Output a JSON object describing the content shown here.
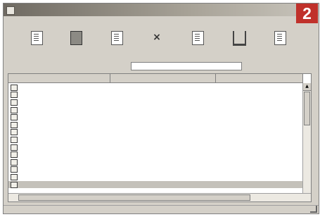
{
  "window": {
    "title": ""
  },
  "badge": {
    "number": "2"
  },
  "menu": [],
  "toolbar": [],
  "path": {
    "label": "",
    "value": ""
  },
  "list": {
    "columns": [],
    "rows": [
      {
        "name": "",
        "perm": "",
        "selected": false
      },
      {
        "name": "",
        "perm": "",
        "selected": false
      },
      {
        "name": "",
        "perm": "",
        "selected": false
      },
      {
        "name": "",
        "perm": "",
        "selected": false
      },
      {
        "name": "",
        "perm": "",
        "selected": false
      },
      {
        "name": "",
        "perm": "",
        "selected": false
      },
      {
        "name": "",
        "perm": "",
        "selected": false
      },
      {
        "name": "",
        "perm": "",
        "selected": false
      },
      {
        "name": "",
        "perm": "",
        "selected": false
      },
      {
        "name": "",
        "perm": "",
        "selected": false
      },
      {
        "name": "",
        "perm": "",
        "selected": false
      },
      {
        "name": "",
        "perm": "",
        "selected": false
      },
      {
        "name": "",
        "perm": "",
        "selected": false
      },
      {
        "name": "",
        "perm": "",
        "selected": true
      }
    ]
  },
  "status": {
    "text": ""
  },
  "colors": {
    "badge": "#c0312b",
    "titlebar": "#6f6a62",
    "face": "#d4d0c8"
  }
}
